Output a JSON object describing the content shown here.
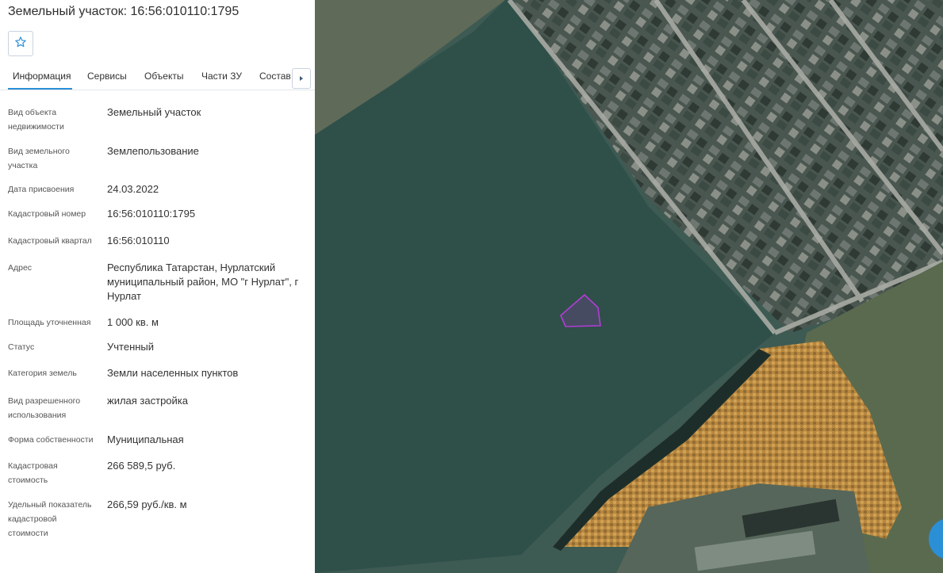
{
  "panel": {
    "title": "Земельный участок: 16:56:010110:1795",
    "tabs": [
      {
        "label": "Информация"
      },
      {
        "label": "Сервисы"
      },
      {
        "label": "Объекты"
      },
      {
        "label": "Части ЗУ"
      },
      {
        "label": "Состав"
      }
    ],
    "fields": [
      {
        "label": "Вид объекта недвижимости",
        "value": "Земельный участок"
      },
      {
        "label": "Вид земельного участка",
        "value": "Землепользование"
      },
      {
        "label": "Дата присвоения",
        "value": "24.03.2022"
      },
      {
        "label": "Кадастровый номер",
        "value": "16:56:010110:1795"
      },
      {
        "label": "Кадастровый квартал",
        "value": "16:56:010110"
      },
      {
        "label": "Адрес",
        "value": "Республика Татарстан, Нурлатский муниципальный район, МО \"г Нурлат\", г Нурлат"
      },
      {
        "label": "Площадь уточненная",
        "value": "1 000 кв. м"
      },
      {
        "label": "Статус",
        "value": "Учтенный"
      },
      {
        "label": "Категория земель",
        "value": "Земли населенных пунктов"
      },
      {
        "label": "Вид разрешенного использования",
        "value": "жилая застройка"
      },
      {
        "label": "Форма собственности",
        "value": "Муниципальная"
      },
      {
        "label": "Кадастровая стоимость",
        "value": "266 589,5 руб."
      },
      {
        "label": "Удельный показатель кадастровой стоимости",
        "value": "266,59 руб./кв. м"
      }
    ]
  },
  "icons": {
    "favorite": "star-outline-icon",
    "tabs_next": "triangle-right-icon"
  },
  "colors": {
    "accent": "#2b8fd6",
    "parcel_outline": "#b43cd8",
    "field": "#2f4f49",
    "forest_autumn": "#b8873e"
  }
}
